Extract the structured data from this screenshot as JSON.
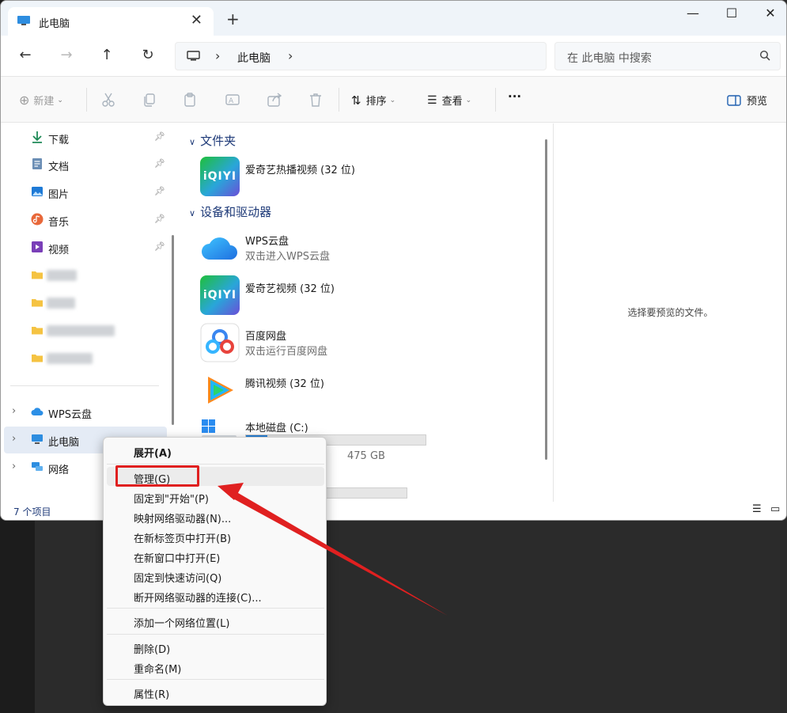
{
  "tab": {
    "title": "此电脑",
    "close": "✕",
    "new": "+"
  },
  "window_controls": {
    "minimize": "—",
    "maximize": "☐",
    "close": "✕"
  },
  "address": {
    "location": "此电脑"
  },
  "search": {
    "placeholder": "在 此电脑 中搜索"
  },
  "toolbar": {
    "new_label": "新建",
    "sort_label": "排序",
    "view_label": "查看",
    "more_label": "···",
    "preview_label": "预览"
  },
  "sidebar": {
    "quick_access": [
      {
        "label": "下载",
        "icon": "download-icon"
      },
      {
        "label": "文档",
        "icon": "document-icon"
      },
      {
        "label": "图片",
        "icon": "pictures-icon"
      },
      {
        "label": "音乐",
        "icon": "music-icon"
      },
      {
        "label": "视频",
        "icon": "video-icon"
      }
    ],
    "roots": [
      {
        "label": "WPS云盘",
        "icon": "cloud-icon"
      },
      {
        "label": "此电脑",
        "icon": "computer-icon"
      },
      {
        "label": "网络",
        "icon": "network-icon"
      }
    ]
  },
  "content": {
    "folders_header": "文件夹",
    "devices_header": "设备和驱动器",
    "folders": [
      {
        "name": "爱奇艺热播视频 (32 位)",
        "icon_text": "iQIYI"
      }
    ],
    "devices": [
      {
        "name": "WPS云盘",
        "sub": "双击进入WPS云盘"
      },
      {
        "name": "爱奇艺视频 (32 位)",
        "icon_text": "iQIYI"
      },
      {
        "name": "百度网盘",
        "sub": "双击运行百度网盘"
      },
      {
        "name": "腾讯视频 (32 位)"
      },
      {
        "name": "本地磁盘 (C:)",
        "size": "475 GB",
        "used_fraction": 0.12
      }
    ]
  },
  "preview_pane": {
    "message": "选择要预览的文件。"
  },
  "status": {
    "count": "7 个项目"
  },
  "context_menu": {
    "items": [
      "展开(A)",
      "管理(G)",
      "固定到\"开始\"(P)",
      "映射网络驱动器(N)...",
      "在新标签页中打开(B)",
      "在新窗口中打开(E)",
      "固定到快速访问(Q)",
      "断开网络驱动器的连接(C)...",
      "添加一个网络位置(L)",
      "删除(D)",
      "重命名(M)",
      "属性(R)"
    ]
  },
  "colors": {
    "accent": "#1e3a78",
    "highlight": "#e02020",
    "selection": "#e4ebf5"
  }
}
